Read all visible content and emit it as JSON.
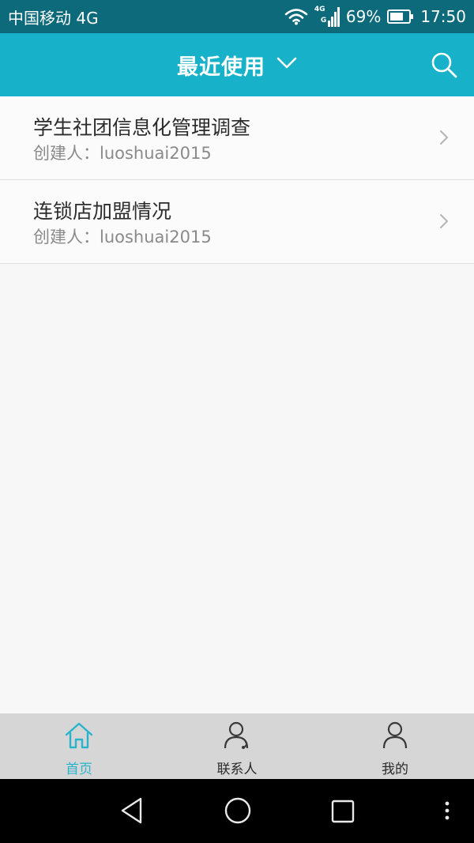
{
  "status_bar": {
    "carrier": "中国移动 4G",
    "network_top": "4G",
    "network_bottom": "G",
    "battery": "69%",
    "time": "17:50",
    "icons": [
      "wifi-icon",
      "signal-icon",
      "battery-icon"
    ]
  },
  "header": {
    "title": "最近使用",
    "icons": [
      "chevron-down-icon",
      "search-icon"
    ]
  },
  "list": {
    "items": [
      {
        "title": "学生社团信息化管理调查",
        "creator": "创建人：luoshuai2015"
      },
      {
        "title": "连锁店加盟情况",
        "creator": "创建人：luoshuai2015"
      }
    ]
  },
  "tabs": [
    {
      "label": "首页",
      "icon": "home-icon",
      "active": true
    },
    {
      "label": "联系人",
      "icon": "contacts-icon",
      "active": false
    },
    {
      "label": "我的",
      "icon": "person-icon",
      "active": false
    }
  ],
  "nav": {
    "icons": [
      "back-icon",
      "home-circle-icon",
      "recents-icon",
      "more-icon"
    ]
  },
  "colors": {
    "status_bar": "#0c6a7b",
    "header": "#17b2c9",
    "accent": "#2ab4cc",
    "tab_bar": "#d6d6d6"
  }
}
